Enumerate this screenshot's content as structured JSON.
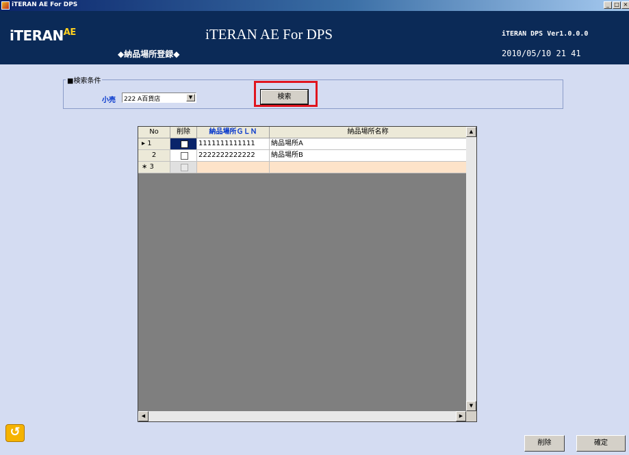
{
  "window": {
    "title": "iTERAN AE For DPS",
    "buttons": [
      "_",
      "□",
      "×"
    ]
  },
  "header": {
    "logo_main": "iTERAN",
    "logo_sup": "AE",
    "app_title": "iTERAN AE For DPS",
    "screen_title": "◆納品場所登録◆",
    "version": "iTERAN DPS Ver1.0.0.0",
    "datetime": "2010/05/10 21 41"
  },
  "search": {
    "group_label": "■検索条件",
    "retail_label": "小売",
    "retail_value": "222 A百貨店",
    "search_button": "検索"
  },
  "grid": {
    "headers": [
      "No",
      "削除",
      "納品場所ＧＬＮ",
      "納品場所名称"
    ],
    "rows": [
      {
        "marker": "▸ 1",
        "delete": false,
        "gln": "1111111111111",
        "name": "納品場所A"
      },
      {
        "marker": "2",
        "delete": false,
        "gln": "2222222222222",
        "name": "納品場所B"
      },
      {
        "marker": "∗ 3",
        "delete": false,
        "gln": "",
        "name": ""
      }
    ]
  },
  "footer": {
    "delete_button": "削除",
    "confirm_button": "確定"
  },
  "colors": {
    "header_bg": "#0b2a57",
    "body_bg": "#d4dcf2",
    "highlight": "#e0141e",
    "new_row_bg": "#fde3c9",
    "gln_header_text": "#0033cc"
  }
}
